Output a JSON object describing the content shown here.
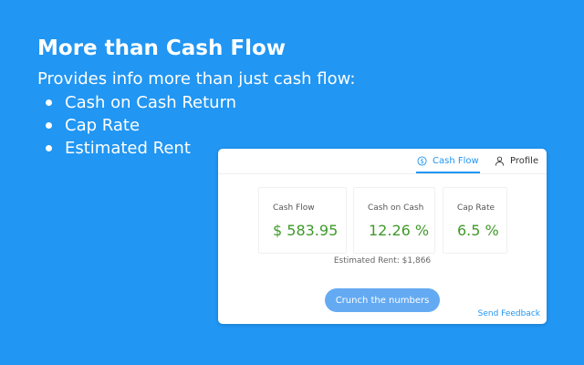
{
  "promo": {
    "title": "More than Cash Flow",
    "subtitle": "Provides info more than just cash flow:",
    "features": [
      "Cash on Cash Return",
      "Cap Rate",
      "Estimated Rent"
    ]
  },
  "popup": {
    "tabs": [
      {
        "label": "Cash Flow",
        "icon": "dollar-circle-icon",
        "active": true
      },
      {
        "label": "Profile",
        "icon": "person-icon",
        "active": false
      }
    ],
    "metrics": [
      {
        "label": "Cash Flow",
        "value": "$ 583.95"
      },
      {
        "label": "Cash on Cash",
        "value": "12.26 %"
      },
      {
        "label": "Cap Rate",
        "value": "6.5 %"
      }
    ],
    "estimated_rent": "Estimated Rent: $1,866",
    "crunch_button": "Crunch the numbers",
    "feedback_link": "Send Feedback"
  },
  "colors": {
    "background": "#2196f3",
    "accent": "#2196f3",
    "value_green": "#3f9a2a",
    "button": "#64aaf3"
  }
}
